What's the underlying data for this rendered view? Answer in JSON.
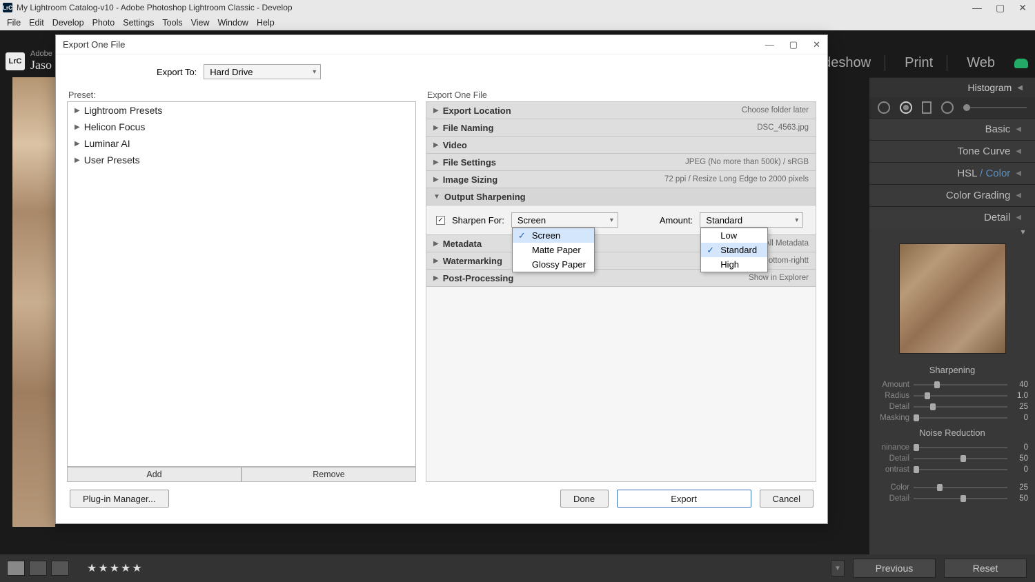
{
  "titlebar": {
    "app_icon_text": "LrC",
    "title": "My Lightroom Catalog-v10 - Adobe Photoshop Lightroom Classic - Develop"
  },
  "menubar": [
    "File",
    "Edit",
    "Develop",
    "Photo",
    "Settings",
    "Tools",
    "View",
    "Window",
    "Help"
  ],
  "modules": [
    "lideshow",
    "Print",
    "Web"
  ],
  "identity": {
    "brand": "Adobe",
    "name": "Jaso"
  },
  "panel_titles": {
    "histogram": "Histogram",
    "basic": "Basic",
    "tone": "Tone Curve",
    "hsl_prefix": "HSL",
    "hsl_suffix": " / Color",
    "grading": "Color Grading",
    "detail": "Detail"
  },
  "detail": {
    "sharpening_title": "Sharpening",
    "nr_title": "Noise Reduction",
    "rows": [
      {
        "label": "Amount",
        "val": "40",
        "pos": 22
      },
      {
        "label": "Radius",
        "val": "1.0",
        "pos": 12
      },
      {
        "label": "Detail",
        "val": "25",
        "pos": 18
      },
      {
        "label": "Masking",
        "val": "0",
        "pos": 0
      }
    ],
    "nr_rows": [
      {
        "label": "ninance",
        "val": "0",
        "pos": 0
      },
      {
        "label": "Detail",
        "val": "50",
        "pos": 50
      },
      {
        "label": "ontrast",
        "val": "0",
        "pos": 0
      }
    ],
    "extra_rows": [
      {
        "label": "Color",
        "val": "25",
        "pos": 25
      },
      {
        "label": "Detail",
        "val": "50",
        "pos": 50
      }
    ]
  },
  "bottombar": {
    "stars": "★★★★★",
    "prev": "Previous",
    "reset": "Reset"
  },
  "dialog": {
    "title": "Export One File",
    "export_to_label": "Export To:",
    "export_to_value": "Hard Drive",
    "preset_label": "Preset:",
    "presets": [
      "Lightroom Presets",
      "Helicon Focus",
      "Luminar AI",
      "User Presets"
    ],
    "add": "Add",
    "remove": "Remove",
    "right_header": "Export One File",
    "sections": [
      {
        "label": "Export Location",
        "right": "Choose folder later"
      },
      {
        "label": "File Naming",
        "right": "DSC_4563.jpg"
      },
      {
        "label": "Video",
        "right": ""
      },
      {
        "label": "File Settings",
        "right": "JPEG (No more than 500k) / sRGB"
      },
      {
        "label": "Image Sizing",
        "right": "72 ppi / Resize Long Edge to 2000 pixels"
      }
    ],
    "sharpening": {
      "title": "Output Sharpening",
      "checkbox_label": "Sharpen For:",
      "for_value": "Screen",
      "for_options": [
        "Screen",
        "Matte Paper",
        "Glossy Paper"
      ],
      "amount_label": "Amount:",
      "amount_value": "Standard",
      "amount_options": [
        "Low",
        "Standard",
        "High"
      ]
    },
    "after_sections": [
      {
        "label": "Metadata",
        "right": "All Metadata"
      },
      {
        "label": "Watermarking",
        "right": "asonPB Bottom-rightt"
      },
      {
        "label": "Post-Processing",
        "right": "Show in Explorer"
      }
    ],
    "plugin": "Plug-in Manager...",
    "done": "Done",
    "export": "Export",
    "cancel": "Cancel"
  }
}
